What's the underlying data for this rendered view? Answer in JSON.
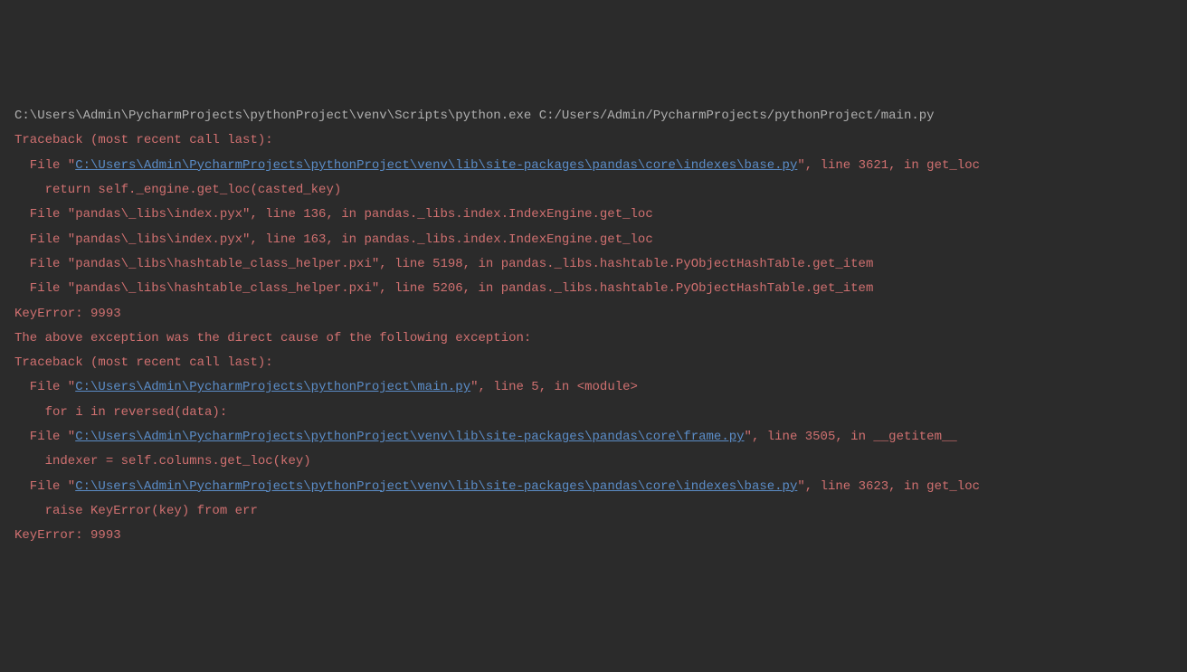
{
  "lines": [
    {
      "segments": [
        {
          "cls": "cmd",
          "text": "C:\\Users\\Admin\\PycharmProjects\\pythonProject\\venv\\Scripts\\python.exe C:/Users/Admin/PycharmProjects/pythonProject/main.py"
        }
      ]
    },
    {
      "segments": [
        {
          "cls": "err",
          "text": "Traceback (most recent call last):"
        }
      ]
    },
    {
      "segments": [
        {
          "cls": "err",
          "text": "  File \""
        },
        {
          "cls": "link",
          "text": "C:\\Users\\Admin\\PycharmProjects\\pythonProject\\venv\\lib\\site-packages\\pandas\\core\\indexes\\base.py"
        },
        {
          "cls": "err",
          "text": "\", line 3621, in get_loc"
        }
      ]
    },
    {
      "segments": [
        {
          "cls": "err",
          "text": "    return self._engine.get_loc(casted_key)"
        }
      ]
    },
    {
      "segments": [
        {
          "cls": "err",
          "text": "  File \"pandas\\_libs\\index.pyx\", line 136, in pandas._libs.index.IndexEngine.get_loc"
        }
      ]
    },
    {
      "segments": [
        {
          "cls": "err",
          "text": "  File \"pandas\\_libs\\index.pyx\", line 163, in pandas._libs.index.IndexEngine.get_loc"
        }
      ]
    },
    {
      "segments": [
        {
          "cls": "err",
          "text": "  File \"pandas\\_libs\\hashtable_class_helper.pxi\", line 5198, in pandas._libs.hashtable.PyObjectHashTable.get_item"
        }
      ]
    },
    {
      "segments": [
        {
          "cls": "err",
          "text": "  File \"pandas\\_libs\\hashtable_class_helper.pxi\", line 5206, in pandas._libs.hashtable.PyObjectHashTable.get_item"
        }
      ]
    },
    {
      "segments": [
        {
          "cls": "err",
          "text": "KeyError: 9993"
        }
      ]
    },
    {
      "segments": [
        {
          "cls": "err",
          "text": ""
        }
      ]
    },
    {
      "segments": [
        {
          "cls": "err",
          "text": "The above exception was the direct cause of the following exception:"
        }
      ]
    },
    {
      "segments": [
        {
          "cls": "err",
          "text": ""
        }
      ]
    },
    {
      "segments": [
        {
          "cls": "err",
          "text": "Traceback (most recent call last):"
        }
      ]
    },
    {
      "segments": [
        {
          "cls": "err",
          "text": "  File \""
        },
        {
          "cls": "link",
          "text": "C:\\Users\\Admin\\PycharmProjects\\pythonProject\\main.py"
        },
        {
          "cls": "err",
          "text": "\", line 5, in <module>"
        }
      ]
    },
    {
      "segments": [
        {
          "cls": "err",
          "text": "    for i in reversed(data):"
        }
      ]
    },
    {
      "segments": [
        {
          "cls": "err",
          "text": "  File \""
        },
        {
          "cls": "link",
          "text": "C:\\Users\\Admin\\PycharmProjects\\pythonProject\\venv\\lib\\site-packages\\pandas\\core\\frame.py"
        },
        {
          "cls": "err",
          "text": "\", line 3505, in __getitem__"
        }
      ]
    },
    {
      "segments": [
        {
          "cls": "err",
          "text": "    indexer = self.columns.get_loc(key)"
        }
      ]
    },
    {
      "segments": [
        {
          "cls": "err",
          "text": "  File \""
        },
        {
          "cls": "link",
          "text": "C:\\Users\\Admin\\PycharmProjects\\pythonProject\\venv\\lib\\site-packages\\pandas\\core\\indexes\\base.py"
        },
        {
          "cls": "err",
          "text": "\", line 3623, in get_loc"
        }
      ]
    },
    {
      "segments": [
        {
          "cls": "err",
          "text": "    raise KeyError(key) from err"
        }
      ]
    },
    {
      "segments": [
        {
          "cls": "err",
          "text": "KeyError: 9993"
        }
      ]
    }
  ]
}
